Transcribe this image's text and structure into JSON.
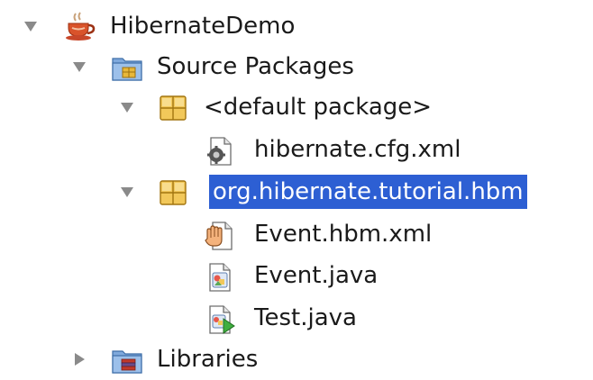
{
  "tree": {
    "project": {
      "label": "HibernateDemo",
      "icon": "coffee-cup-icon",
      "expanded": true
    },
    "source_packages": {
      "label": "Source Packages",
      "icon": "source-packages-folder-icon",
      "expanded": true
    },
    "default_package": {
      "label": "<default package>",
      "icon": "package-icon",
      "expanded": true
    },
    "cfg_file": {
      "label": "hibernate.cfg.xml",
      "icon": "xml-config-file-icon"
    },
    "hbm_package": {
      "label": "org.hibernate.tutorial.hbm",
      "icon": "package-icon",
      "expanded": true,
      "selected": true
    },
    "event_hbm": {
      "label": "Event.hbm.xml",
      "icon": "hand-xml-file-icon"
    },
    "event_java": {
      "label": "Event.java",
      "icon": "java-class-file-icon"
    },
    "test_java": {
      "label": "Test.java",
      "icon": "java-main-class-file-icon"
    },
    "libraries": {
      "label": "Libraries",
      "icon": "libraries-folder-icon",
      "expanded": false
    }
  },
  "colors": {
    "selection": "#2d5fd3",
    "package": "#e8b83a",
    "folder": "#6f9fd8",
    "toggle": "#8a8a8a"
  }
}
